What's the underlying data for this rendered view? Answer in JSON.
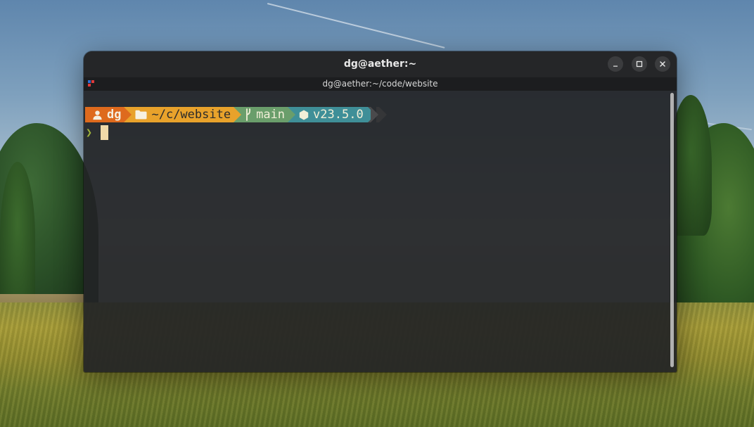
{
  "window": {
    "title": "dg@aether:~",
    "controls": {
      "minimize": "minimize",
      "maximize": "maximize",
      "close": "close"
    }
  },
  "tab": {
    "title": "dg@aether:~/code/website"
  },
  "prompt": {
    "user": "dg",
    "directory": "~/c/website",
    "git_branch": "main",
    "node_version": "v23.5.0",
    "input_symbol": "❯",
    "input": ""
  },
  "colors": {
    "user_segment": "#de6a1d",
    "dir_segment": "#e8a22b",
    "git_segment": "#6a9e6b",
    "node_segment": "#3f8f98",
    "cursor": "#f0d9a8",
    "chevron": "#9fb33a"
  },
  "icons": {
    "user": "user-icon",
    "directory": "folder-icon",
    "git": "git-branch-icon",
    "node": "nodejs-hexagon-icon",
    "tab": "terminal-app-icon"
  }
}
